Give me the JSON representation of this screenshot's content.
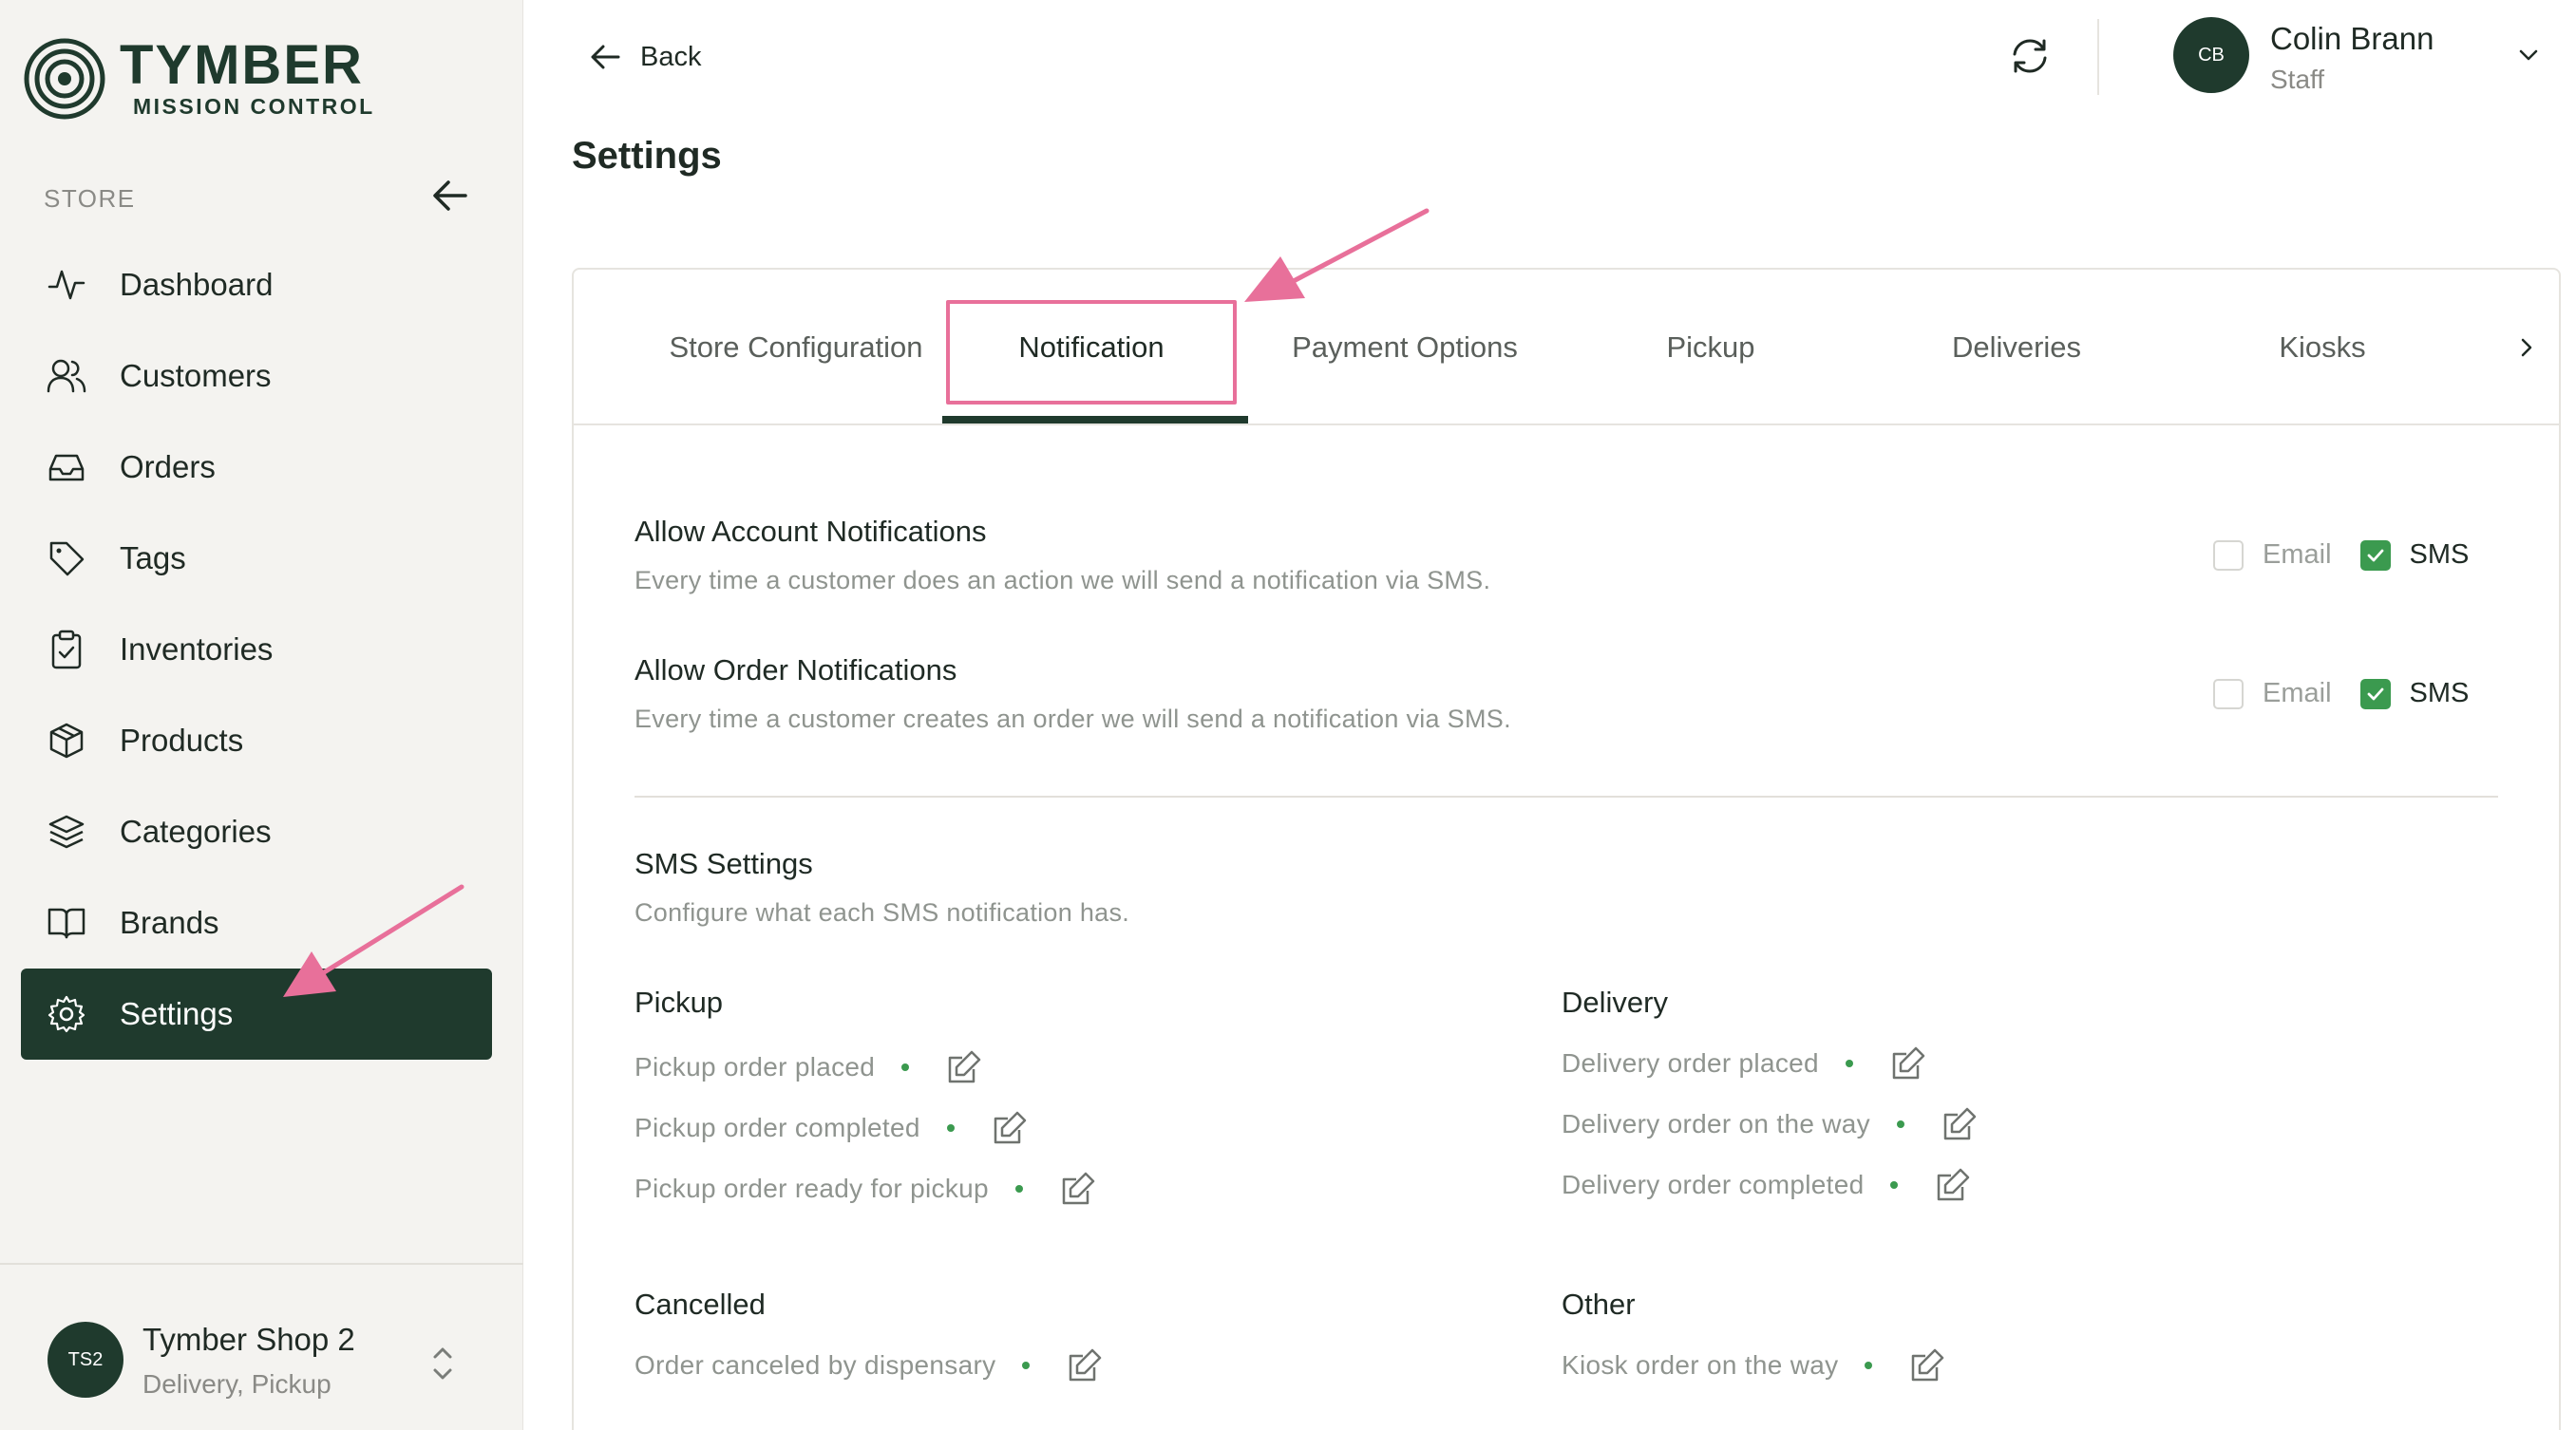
{
  "brand": {
    "name": "TYMBER",
    "tagline": "MISSION CONTROL"
  },
  "sidebar": {
    "section_label": "STORE",
    "items": [
      {
        "label": "Dashboard",
        "icon": "activity-icon"
      },
      {
        "label": "Customers",
        "icon": "users-icon"
      },
      {
        "label": "Orders",
        "icon": "inbox-icon"
      },
      {
        "label": "Tags",
        "icon": "tag-icon"
      },
      {
        "label": "Inventories",
        "icon": "clipboard-check-icon"
      },
      {
        "label": "Products",
        "icon": "box-icon"
      },
      {
        "label": "Categories",
        "icon": "layers-icon"
      },
      {
        "label": "Brands",
        "icon": "book-open-icon"
      },
      {
        "label": "Settings",
        "icon": "gear-icon",
        "active": true
      }
    ],
    "shop": {
      "initials": "TS2",
      "name": "Tymber Shop 2",
      "subtitle": "Delivery, Pickup"
    }
  },
  "topbar": {
    "back_label": "Back",
    "user": {
      "initials": "CB",
      "name": "Colin Brann",
      "role": "Staff"
    }
  },
  "page": {
    "title": "Settings"
  },
  "tabs": [
    {
      "label": "Store Configuration"
    },
    {
      "label": "Notification",
      "active": true
    },
    {
      "label": "Payment Options"
    },
    {
      "label": "Pickup"
    },
    {
      "label": "Deliveries"
    },
    {
      "label": "Kiosks"
    }
  ],
  "notifications": {
    "account": {
      "title": "Allow Account Notifications",
      "description": "Every time a customer does an action we will send a notification via SMS.",
      "email_label": "Email",
      "email_checked": false,
      "sms_label": "SMS",
      "sms_checked": true
    },
    "order": {
      "title": "Allow Order Notifications",
      "description": "Every time a customer creates an order we will send a notification via SMS.",
      "email_label": "Email",
      "email_checked": false,
      "sms_label": "SMS",
      "sms_checked": true
    }
  },
  "sms_settings": {
    "title": "SMS Settings",
    "description": "Configure what each SMS notification has.",
    "groups": {
      "pickup": {
        "title": "Pickup",
        "items": [
          "Pickup order placed",
          "Pickup order completed",
          "Pickup order ready for pickup"
        ]
      },
      "delivery": {
        "title": "Delivery",
        "items": [
          "Delivery order placed",
          "Delivery order on the way",
          "Delivery order completed"
        ]
      },
      "cancelled": {
        "title": "Cancelled",
        "items": [
          "Order canceled by dispensary"
        ]
      },
      "other": {
        "title": "Other",
        "items": [
          "Kiosk order on the way"
        ]
      }
    }
  },
  "colors": {
    "brand_dark_green": "#1f3a2d",
    "check_green": "#3b9a4f",
    "annotation_pink": "#e8709a",
    "sidebar_bg": "#f4f3f0"
  }
}
